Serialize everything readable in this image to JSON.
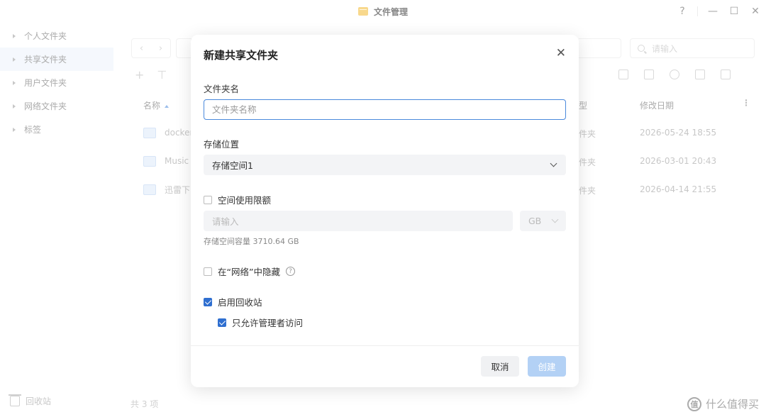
{
  "app": {
    "title": "文件管理"
  },
  "window": {
    "help": "?",
    "minimize": "—",
    "maximize": "☐",
    "close": "✕"
  },
  "sidebar": {
    "items": [
      {
        "label": "个人文件夹"
      },
      {
        "label": "共享文件夹"
      },
      {
        "label": "用户文件夹"
      },
      {
        "label": "网络文件夹"
      },
      {
        "label": "标签"
      }
    ],
    "recycle_label": "回收站"
  },
  "main": {
    "search_placeholder": "请输入",
    "columns": {
      "name": "名称",
      "type": "型",
      "date": "修改日期"
    },
    "files": [
      {
        "name": "docker",
        "type": "件夹",
        "date": "2026-05-24 18:55"
      },
      {
        "name": "Music",
        "type": "件夹",
        "date": "2026-03-01 20:43"
      },
      {
        "name": "迅雷下",
        "type": "件夹",
        "date": "2026-04-14 21:55"
      }
    ],
    "count_label": "共 3 项"
  },
  "dialog": {
    "title": "新建共享文件夹",
    "name_label": "文件夹名",
    "name_placeholder": "文件夹名称",
    "storage_label": "存储位置",
    "storage_value": "存储空间1",
    "quota_label": "空间使用限额",
    "quota_placeholder": "请输入",
    "quota_unit": "GB",
    "capacity_hint": "存储空间容量 3710.64 GB",
    "hide_label": "在“网络”中隐藏",
    "recycle_label": "启用回收站",
    "admin_only_label": "只允许管理者访问",
    "cancel_label": "取消",
    "create_label": "创建"
  },
  "watermark": {
    "text": "什么值得买",
    "logo": "值"
  }
}
